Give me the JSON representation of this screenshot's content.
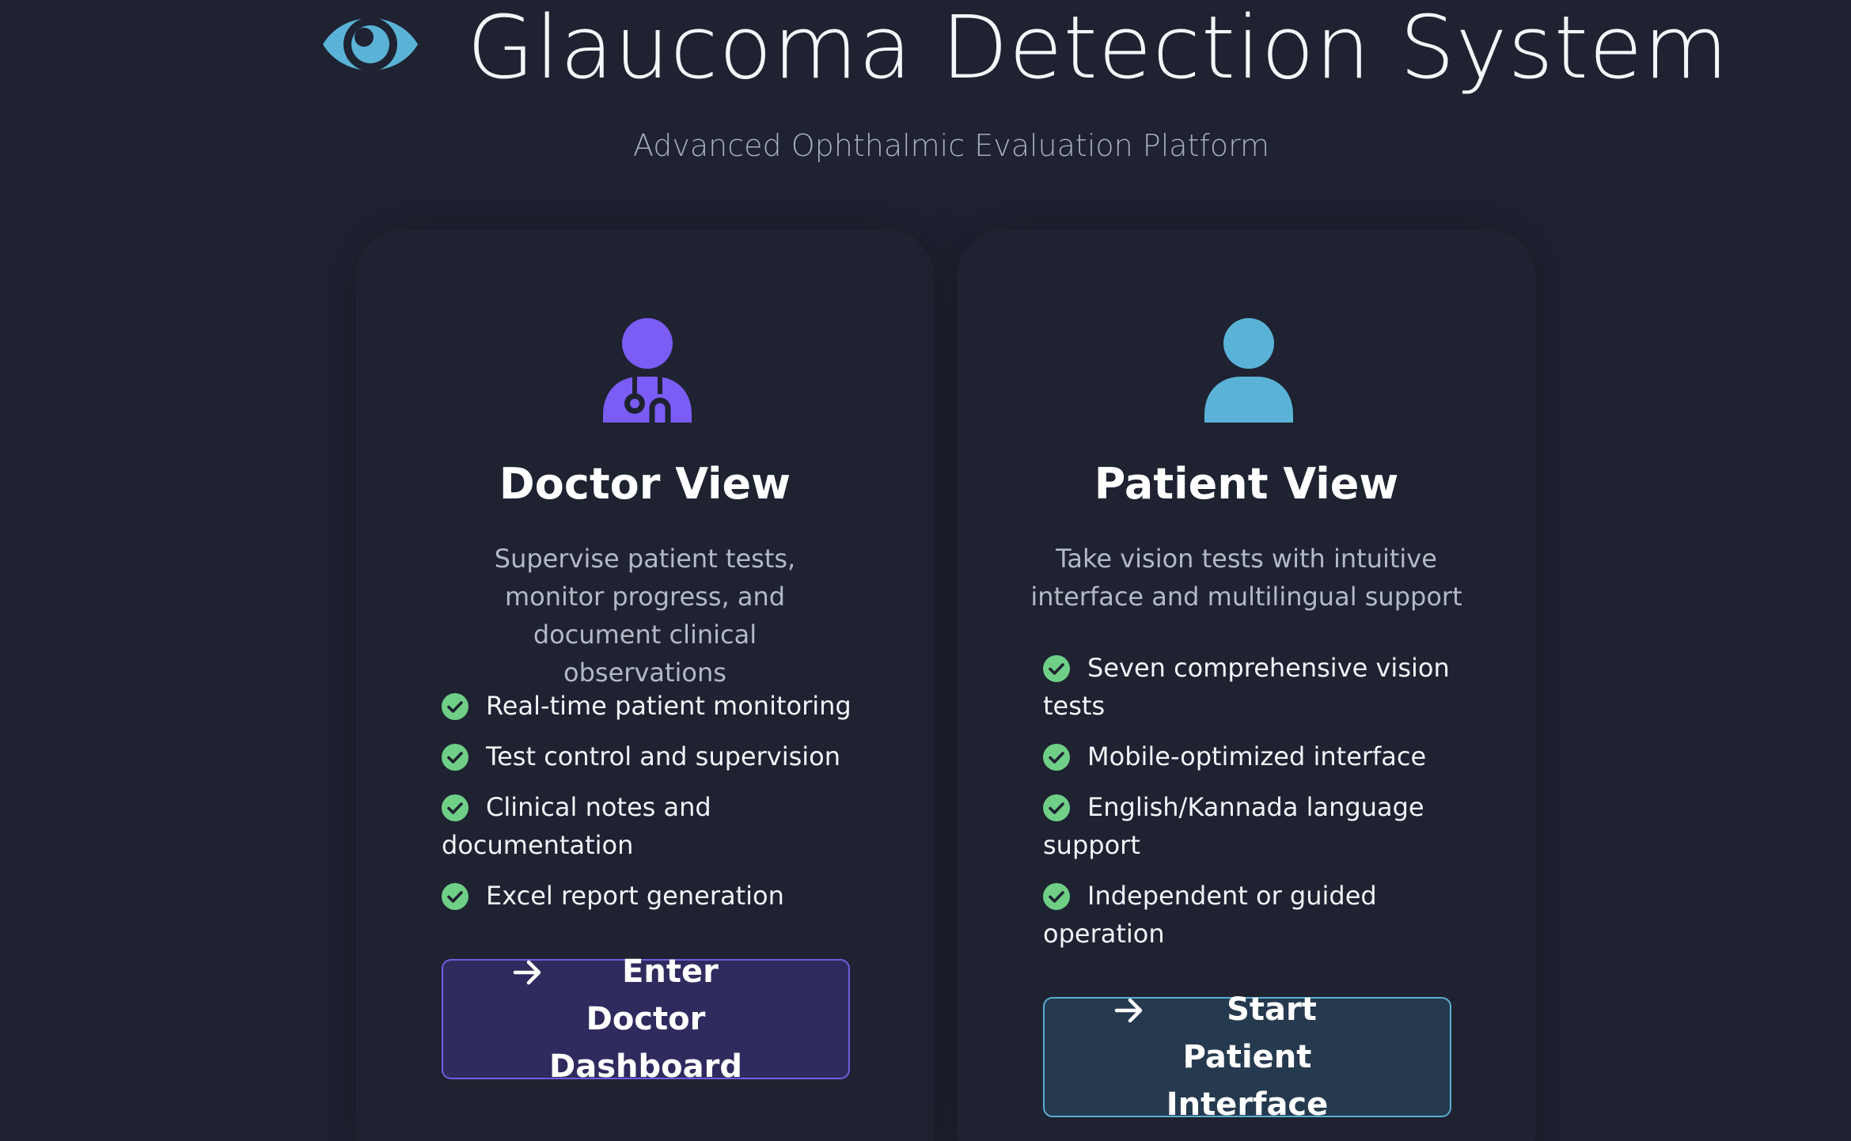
{
  "header": {
    "title": "Glaucoma Detection System",
    "subtitle": "Advanced Ophthalmic Evaluation Platform",
    "logo_icon": "eye-icon"
  },
  "colors": {
    "background": "#1e2231",
    "doctor_accent": "#7b5cf5",
    "patient_accent": "#5ab3d6",
    "check_green": "#6fcf86"
  },
  "cards": {
    "doctor": {
      "icon": "user-doctor-icon",
      "title": "Doctor View",
      "description": "Supervise patient tests, monitor progress, and document clinical observations",
      "features": [
        "Real-time patient monitoring",
        "Test control and supervision",
        "Clinical notes and documentation",
        "Excel report generation"
      ],
      "button_icon": "arrow-right-icon",
      "button_label": "Enter Doctor Dashboard"
    },
    "patient": {
      "icon": "user-icon",
      "title": "Patient View",
      "description": "Take vision tests with intuitive interface and multilingual support",
      "features": [
        "Seven comprehensive vision tests",
        "Mobile-optimized interface",
        "English/Kannada language support",
        "Independent or guided operation"
      ],
      "button_icon": "arrow-right-icon",
      "button_label": "Start Patient Interface"
    }
  }
}
